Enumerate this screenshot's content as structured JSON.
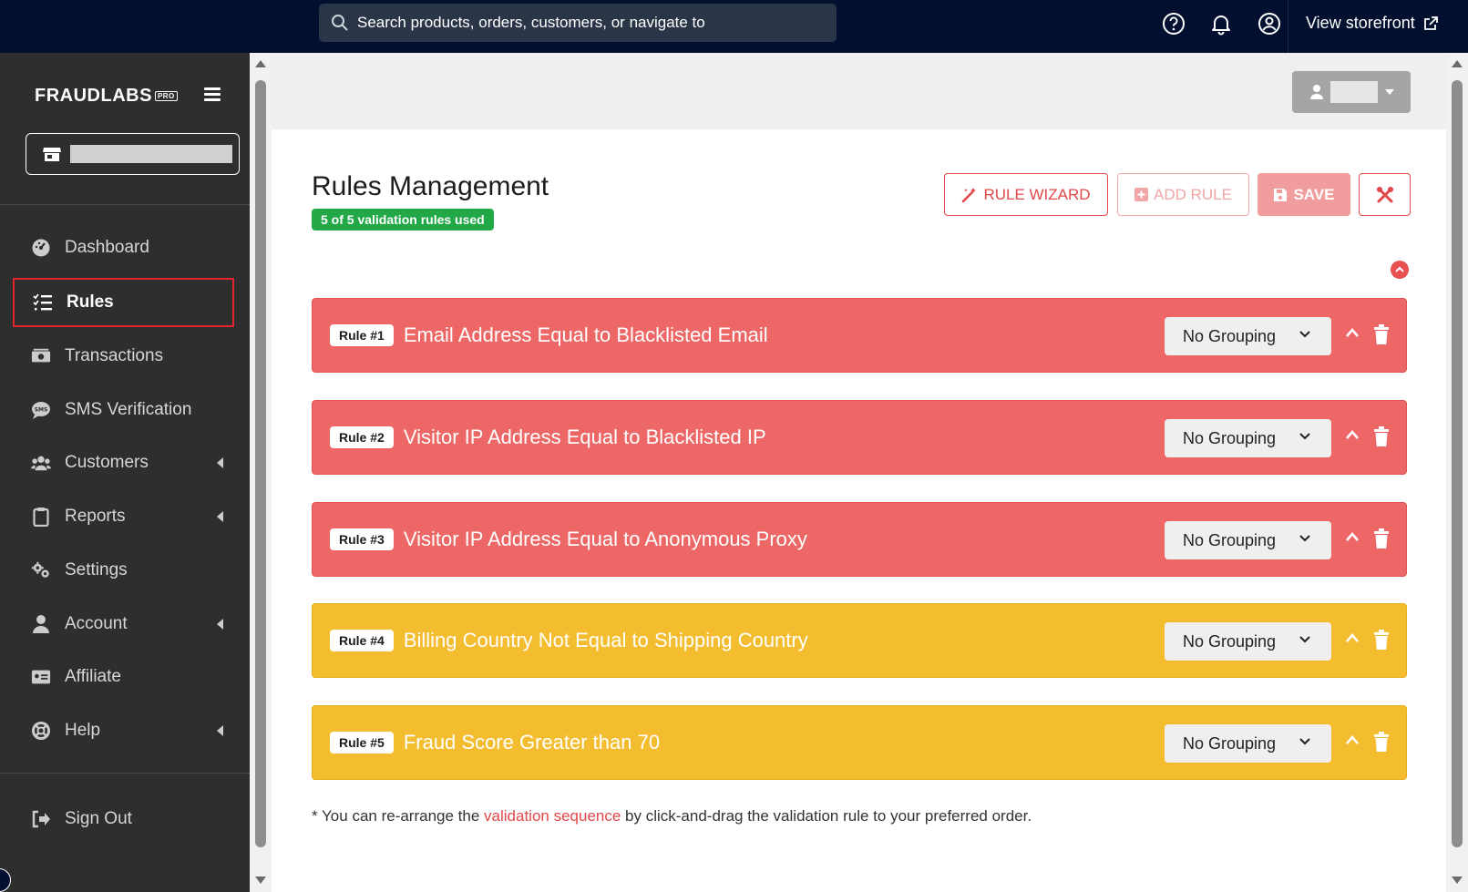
{
  "topbar": {
    "search_placeholder": "Search products, orders, customers, or navigate to",
    "storefront_label": "View storefront"
  },
  "sidebar": {
    "logo_text": "FRAUDLABS",
    "logo_badge": "PRO",
    "items": [
      {
        "label": "Dashboard",
        "icon": "dashboard-icon"
      },
      {
        "label": "Rules",
        "icon": "rules-list-icon",
        "active": true
      },
      {
        "label": "Transactions",
        "icon": "transactions-icon"
      },
      {
        "label": "SMS Verification",
        "icon": "sms-icon"
      },
      {
        "label": "Customers",
        "icon": "users-icon",
        "has_submenu": true
      },
      {
        "label": "Reports",
        "icon": "clipboard-icon",
        "has_submenu": true
      },
      {
        "label": "Settings",
        "icon": "gears-icon"
      },
      {
        "label": "Account",
        "icon": "user-icon",
        "has_submenu": true
      },
      {
        "label": "Affiliate",
        "icon": "id-card-icon"
      },
      {
        "label": "Help",
        "icon": "lifebuoy-icon",
        "has_submenu": true
      }
    ],
    "sign_out_label": "Sign Out"
  },
  "main": {
    "title": "Rules Management",
    "usage_badge": "5 of 5 validation rules used",
    "buttons": {
      "rule_wizard": "RULE WIZARD",
      "add_rule": "ADD RULE",
      "save": "SAVE"
    },
    "rules": [
      {
        "badge": "Rule #1",
        "title": "Email Address Equal to Blacklisted Email",
        "grouping": "No Grouping",
        "color": "#ec6766"
      },
      {
        "badge": "Rule #2",
        "title": "Visitor IP Address Equal to Blacklisted IP",
        "grouping": "No Grouping",
        "color": "#ec6766"
      },
      {
        "badge": "Rule #3",
        "title": "Visitor IP Address Equal to Anonymous Proxy",
        "grouping": "No Grouping",
        "color": "#ec6766"
      },
      {
        "badge": "Rule #4",
        "title": "Billing Country Not Equal to Shipping Country",
        "grouping": "No Grouping",
        "color": "#f4bd2f"
      },
      {
        "badge": "Rule #5",
        "title": "Fraud Score Greater than 70",
        "grouping": "No Grouping",
        "color": "#f4bd2f"
      }
    ],
    "footnote": {
      "before": "* You can re-arrange the ",
      "link": "validation sequence",
      "after": " by click-and-drag the validation rule to your preferred order."
    }
  },
  "colors": {
    "topbar": "#030f2e",
    "sidebar": "#2e2e2e",
    "accent_red": "#e2474a",
    "rule_red": "#ec6766",
    "rule_yellow": "#f4bd2f",
    "badge_green": "#22a847"
  }
}
